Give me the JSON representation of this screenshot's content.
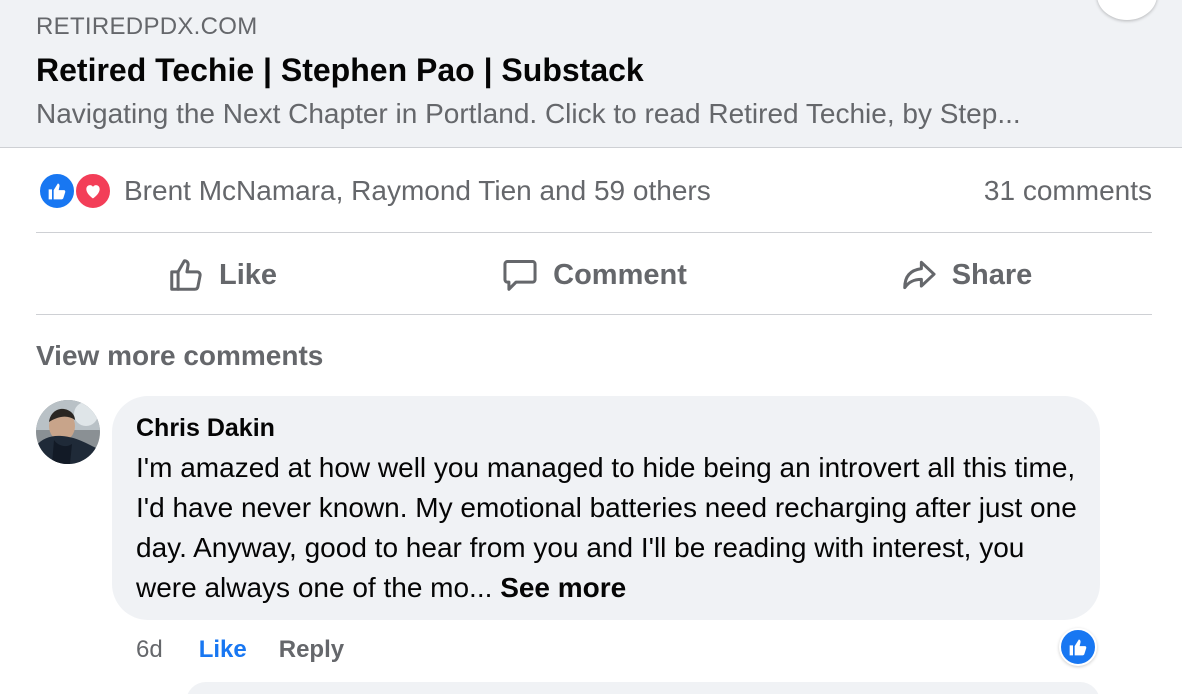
{
  "link_preview": {
    "domain": "RETIREDPDX.COM",
    "title": "Retired Techie | Stephen Pao | Substack",
    "description": "Navigating the Next Chapter in Portland. Click to read Retired Techie, by Step..."
  },
  "reactions": {
    "icons": [
      "like-icon",
      "love-icon"
    ],
    "summary": "Brent McNamara, Raymond Tien and 59 others",
    "comment_count": "31 comments"
  },
  "actions": {
    "like": "Like",
    "comment": "Comment",
    "share": "Share"
  },
  "comments_section": {
    "view_more": "View more comments",
    "comments": [
      {
        "author": "Chris Dakin",
        "text": "I'm amazed at how well you managed to hide being an introvert all this time, I'd have never known. My emotional batteries need recharging after just one day. Anyway, good to hear from you and I'll be reading with interest, you were always one of the mo...",
        "see_more": "See more",
        "time": "6d",
        "like_label": "Like",
        "reply_label": "Reply",
        "reaction_icon": "like-icon"
      }
    ]
  },
  "colors": {
    "accent": "#1877f2",
    "love": "#f33e58",
    "secondary_text": "#65676b",
    "card_background": "#f0f2f5"
  }
}
